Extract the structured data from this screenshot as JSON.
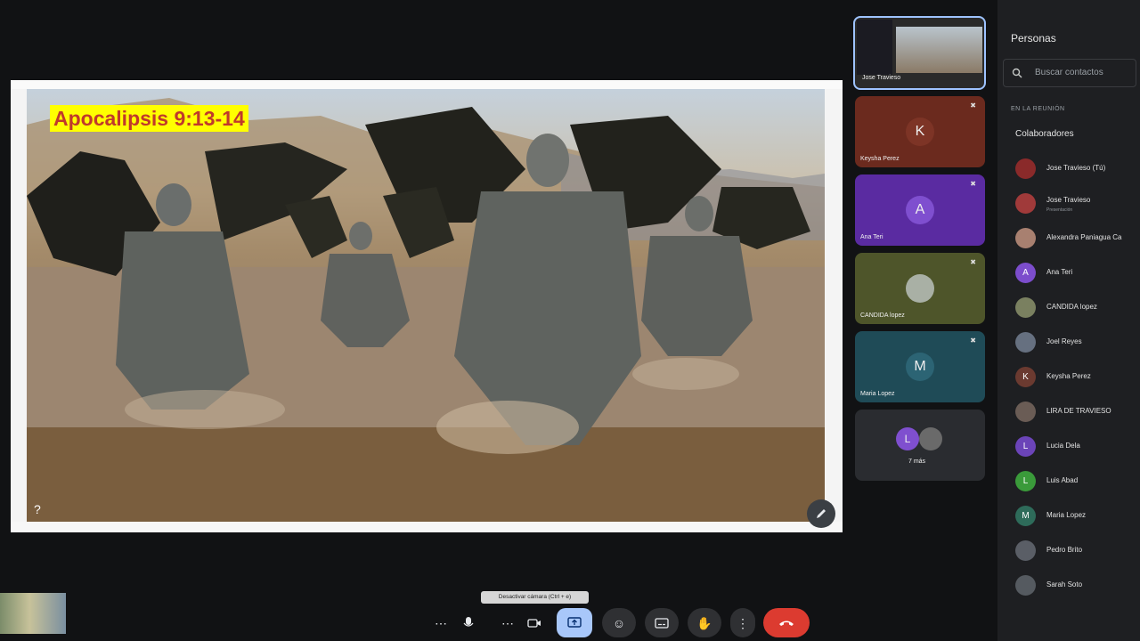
{
  "slide": {
    "title": "Apocalipsis 9:13-14",
    "corner_mark": "?"
  },
  "self_tile": {
    "name": "Jose Travieso"
  },
  "tiles": [
    {
      "initial": "K",
      "name": "Keysha Perez",
      "color": "#6b2a1e"
    },
    {
      "initial": "A",
      "name": "Ana Teri",
      "color": "#5a2ba1"
    },
    {
      "initial": "",
      "name": "CANDIDA lopez",
      "color": "#4e552a"
    },
    {
      "initial": "M",
      "name": "Maria Lopez",
      "color": "#1f4b57"
    },
    {
      "initial": "L",
      "name": "7 más",
      "color": "#2a2c30"
    }
  ],
  "people_panel": {
    "title": "Personas",
    "search_placeholder": "Buscar contactos",
    "section": "EN LA REUNIÓN",
    "group": "Colaboradores",
    "people": [
      {
        "name": "Jose Travieso (Tú)",
        "sub": "",
        "initial": "",
        "color": "#8a2a2a"
      },
      {
        "name": "Jose Travieso",
        "sub": "Presentación",
        "initial": "",
        "color": "#a03a3a"
      },
      {
        "name": "Alexandra Paniagua Ca",
        "sub": "",
        "initial": "",
        "color": "#a88070"
      },
      {
        "name": "Ana Teri",
        "sub": "",
        "initial": "A",
        "color": "#7c4dcc"
      },
      {
        "name": "CANDIDA lopez",
        "sub": "",
        "initial": "",
        "color": "#7a8060"
      },
      {
        "name": "Joel Reyes",
        "sub": "",
        "initial": "",
        "color": "#667080"
      },
      {
        "name": "Keysha Perez",
        "sub": "",
        "initial": "K",
        "color": "#6b3a30"
      },
      {
        "name": "LIRA DE TRAVIESO",
        "sub": "",
        "initial": "",
        "color": "#6a5c55"
      },
      {
        "name": "Lucia Dela",
        "sub": "",
        "initial": "L",
        "color": "#6b44b8"
      },
      {
        "name": "Luis Abad",
        "sub": "",
        "initial": "L",
        "color": "#3a9a3a"
      },
      {
        "name": "Maria Lopez",
        "sub": "",
        "initial": "M",
        "color": "#2e6b5a"
      },
      {
        "name": "Pedro Brito",
        "sub": "",
        "initial": "",
        "color": "#5a5e66"
      },
      {
        "name": "Sarah Soto",
        "sub": "",
        "initial": "",
        "color": "#555a60"
      }
    ]
  },
  "toolbar": {
    "tooltip": "Desactivar cámara (Ctrl + e)",
    "buttons": [
      "more-mic-options",
      "microphone",
      "more-camera-options",
      "camera",
      "present-screen",
      "emoji-reactions",
      "captions",
      "raise-hand",
      "more-options",
      "leave-call"
    ]
  },
  "colors": {
    "present_active": "#a8c7fa",
    "leave": "#dc3b30"
  }
}
